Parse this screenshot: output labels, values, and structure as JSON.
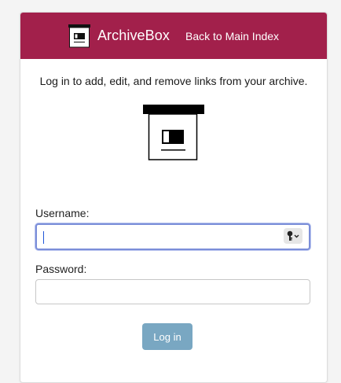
{
  "header": {
    "brand_name": "ArchiveBox",
    "back_link": "Back to Main Index",
    "background_color": "#a2204b"
  },
  "intro_text": "Log in to add, edit, and remove links from your archive.",
  "logo": {
    "icon": "archivebox-logo-icon"
  },
  "form": {
    "username_label": "Username:",
    "username_value": "",
    "password_label": "Password:",
    "password_value": "",
    "password_manager_icon": "key-icon",
    "submit_label": "Log in",
    "submit_color": "#79a7c2"
  }
}
